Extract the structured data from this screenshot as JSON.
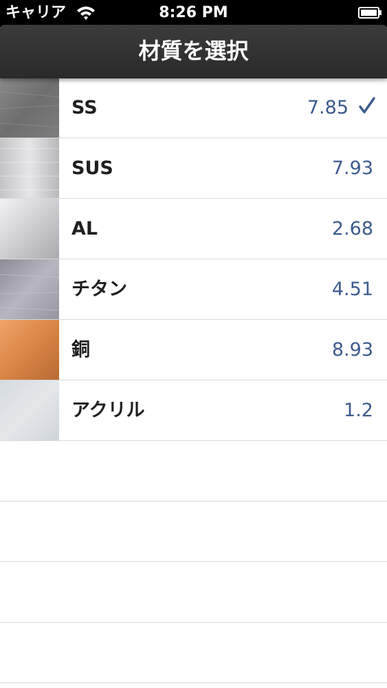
{
  "status_bar": {
    "carrier": "キャリア",
    "time": "8:26 PM",
    "icons": [
      "wifi-icon",
      "battery-icon"
    ]
  },
  "navigation": {
    "title": "材質を選択",
    "background_color": "#2f2f2f"
  },
  "materials": [
    {
      "name": "SS",
      "value": "7.85",
      "selected": true,
      "texture": "dark-gray-steel"
    },
    {
      "name": "SUS",
      "value": "7.93",
      "selected": false,
      "texture": "brushed-stainless"
    },
    {
      "name": "AL",
      "value": "2.68",
      "selected": false,
      "texture": "light-aluminum"
    },
    {
      "name": "チタン",
      "value": "4.51",
      "selected": false,
      "texture": "titanium"
    },
    {
      "name": "銅",
      "value": "8.93",
      "selected": false,
      "texture": "copper"
    },
    {
      "name": "アクリル",
      "value": "1.2",
      "selected": false,
      "texture": "acrylic"
    }
  ],
  "selection_icon": "checkmark-icon",
  "colors": {
    "value_text": "#3b5b8e",
    "label_text": "#1f1f1f",
    "separator": "#d9d9d9"
  }
}
